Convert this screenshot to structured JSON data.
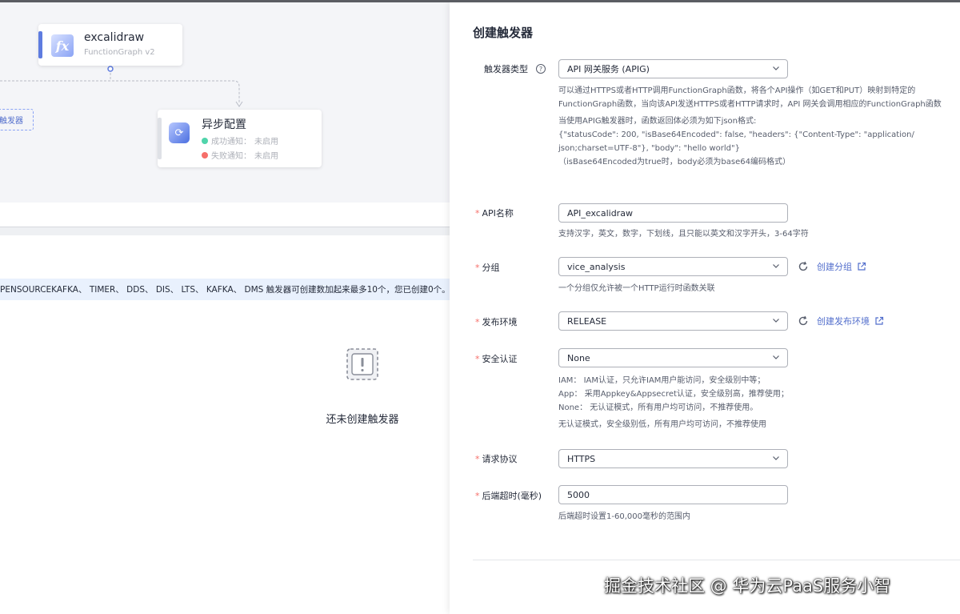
{
  "canvas": {
    "function_node": {
      "title": "excalidraw",
      "subtitle": "FunctionGraph v2",
      "logo": "fx-function-icon"
    },
    "async_node": {
      "title": "异步配置",
      "success_label": "成功通知：",
      "success_value": "未启用",
      "failure_label": "失败通知：",
      "failure_value": "未启用",
      "colors": {
        "success": "#50d4ab",
        "failure": "#f66f6a"
      }
    },
    "trigger_placeholder": "触发器"
  },
  "trigger_panel": {
    "info": "PENSOURCEKAFKA、 TIMER、 DDS、 DIS、 LTS、 KAFKA、 DMS 触发器可创建数加起来最多10个，您已创建0个。",
    "empty_text": "还未创建触发器"
  },
  "drawer": {
    "title": "创建触发器",
    "trigger_type": {
      "label": "触发器类型",
      "value": "API 网关服务 (APIG)",
      "desc_lines": [
        "可以通过HTTPS或者HTTP调用FunctionGraph函数，将各个API操作（如GET和PUT）映射到特定的",
        "FunctionGraph函数，当向该API发送HTTPS或者HTTP请求时，API 网关会调用相应的FunctionGraph函数",
        "当使用APIG触发器时，函数返回体必须为如下json格式:",
        "{\"statusCode\": 200, \"isBase64Encoded\": false, \"headers\": {\"Content-Type\": \"application/",
        "json;charset=UTF-8\"}, \"body\": \"hello world\"}",
        "（isBase64Encoded为true时，body必须为base64编码格式）"
      ]
    },
    "api_name": {
      "label": "API名称",
      "value": "API_excalidraw",
      "desc": "支持汉字，英文，数字，下划线，且只能以英文和汉字开头，3-64字符"
    },
    "group": {
      "label": "分组",
      "value": "vice_analysis",
      "action": "创建分组",
      "desc": "一个分组仅允许被一个HTTP运行时函数关联"
    },
    "env": {
      "label": "发布环境",
      "value": "RELEASE",
      "action": "创建发布环境"
    },
    "auth": {
      "label": "安全认证",
      "value": "None",
      "desc_lines": [
        "IAM：  IAM认证，只允许IAM用户能访问，安全级别中等；",
        "App：  采用Appkey&Appsecret认证，安全级别高，推荐使用；",
        "None：  无认证模式，所有用户均可访问，不推荐使用。",
        "无认证模式，安全级别低，所有用户均可访问，不推荐使用"
      ]
    },
    "protocol": {
      "label": "请求协议",
      "value": "HTTPS"
    },
    "timeout": {
      "label": "后端超时(毫秒)",
      "value": "5000",
      "desc": "后端超时设置1-60,000毫秒的范围内"
    },
    "required_mark": "*"
  },
  "watermark": "掘金技术社区 @ 华为云PaaS服务小智",
  "colors": {
    "accent": "#526ecc",
    "required": "#f66f6a",
    "border": "#adb0b8"
  }
}
